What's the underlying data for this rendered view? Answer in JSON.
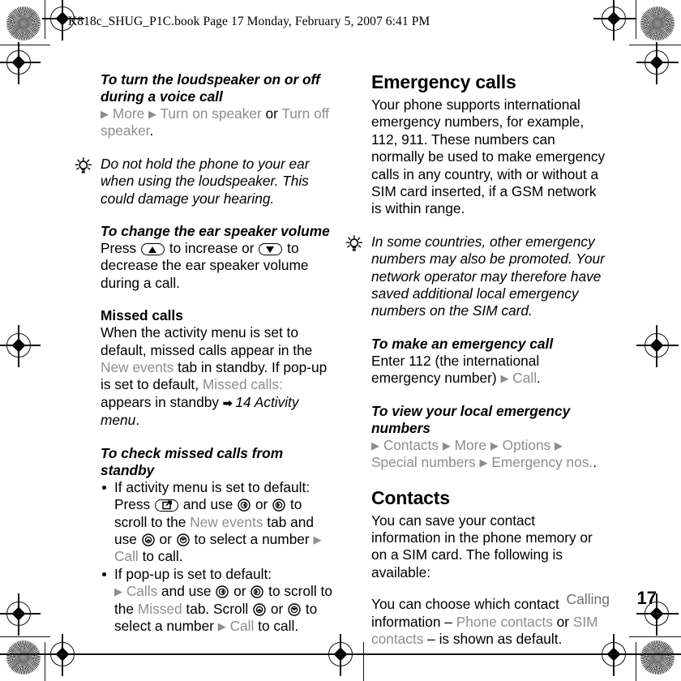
{
  "prepress": {
    "file_stamp": "K818c_SHUG_P1C.book  Page 17  Monday, February 5, 2007  6:41 PM"
  },
  "left_column": {
    "blocks": [
      {
        "kind": "task-heading",
        "text": "To turn the loudspeaker on or off during a voice call"
      },
      {
        "kind": "path",
        "parts": [
          "▸",
          "More",
          "▸",
          "Turn on speaker",
          "or",
          "Turn off speaker",
          "."
        ]
      },
      {
        "kind": "note",
        "icon": "lightbulb-icon",
        "text": "Do not hold the phone to your ear when using the loudspeaker. This could damage your hearing."
      },
      {
        "kind": "task-heading",
        "text": "To change the ear speaker volume"
      },
      {
        "kind": "body-with-keys",
        "segments": [
          "Press ",
          "volume-up-key",
          " to increase or ",
          "volume-down-key",
          " to decrease the ear speaker volume during a call."
        ]
      },
      {
        "kind": "sub-heading",
        "text": "Missed calls"
      },
      {
        "kind": "body",
        "text": "When the activity menu is set to default, missed calls appear in the New events tab in standby. If pop-up is set to default, Missed calls: appears in standby ➡ 14 Activity menu."
      },
      {
        "kind": "task-heading",
        "text": "To check missed calls from standby"
      },
      {
        "kind": "bullet",
        "text": "If activity menu is set to default: Press (activity key) and use (nav-left) or (nav-right) to scroll to the New events tab and use (nav-up) or (nav-down) to select a number ▸ Call to call."
      },
      {
        "kind": "bullet",
        "text": "If pop-up is set to default: ▸ Calls and use (nav-left) or (nav-right) to scroll to the Missed tab. Scroll (nav-up) or (nav-down) to select a number ▸ Call to call."
      }
    ],
    "t1_line1": "To turn the loudspeaker on or off",
    "t1_line2": "during a voice call",
    "p1_more": "More",
    "p1_turn_on": "Turn on speaker",
    "p1_or": "or",
    "p1_turn_off": "Turn off speaker",
    "note1": "Do not hold the phone to your ear when using the loudspeaker. This could damage your hearing.",
    "t2": "To change the ear speaker volume",
    "t2_a": "Press",
    "t2_b": "to increase or",
    "t2_c": "to decrease the ear speaker volume during a call.",
    "h_missed": "Missed calls",
    "missed_a": "When the activity menu is set to default, missed calls appear in the",
    "missed_new_events": "New events",
    "missed_b": "tab in standby. If pop-up is set to default,",
    "missed_calls_label": "Missed calls:",
    "missed_c": "appears in standby",
    "missed_ref": "14 Activity menu",
    "t3": "To check missed calls from standby",
    "b1_a": "If activity menu is set to default: Press",
    "b1_b": "and use",
    "b1_or1": "or",
    "b1_c": "to scroll to the",
    "b1_new_events": "New events",
    "b1_d": "tab and use",
    "b1_or2": "or",
    "b1_e": "to select a number",
    "b1_call": "Call",
    "b1_f": "to call.",
    "b2_a": "If pop-up is set to default:",
    "b2_calls": "Calls",
    "b2_b": "and use",
    "b2_or1": "or",
    "b2_c": "to scroll to the",
    "b2_missed": "Missed",
    "b2_d": "tab. Scroll",
    "b2_or2": "or",
    "b2_e": "to select a number",
    "b2_call": "Call",
    "b2_f": "to call."
  },
  "right_column": {
    "h_emergency": "Emergency calls",
    "emergency_body": "Your phone supports international emergency numbers, for example, 112, 911. These numbers can normally be used to make emergency calls in any country, with or without a SIM card inserted, if a GSM network is within range.",
    "note2": "In some countries, other emergency numbers may also be promoted. Your network operator may therefore have saved additional local emergency numbers on the SIM card.",
    "t_make_call": "To make an emergency call",
    "make_call_a": "Enter 112 (the international emergency number)",
    "make_call_btn": "Call",
    "make_call_dot": ".",
    "t_view_line1": "To view your local emergency",
    "t_view_line2": "numbers",
    "path_contacts": "Contacts",
    "path_more": "More",
    "path_options": "Options",
    "path_special": "Special numbers",
    "path_emerg_nos": "Emergency nos.",
    "path_dot": ".",
    "h_contacts": "Contacts",
    "contacts_body1": "You can save your contact information in the phone memory or on a SIM card. The following is available:",
    "contacts_body2_a": "You can choose which contact information –",
    "contacts_phone": "Phone contacts",
    "contacts_or": "or",
    "contacts_sim": "SIM contacts",
    "contacts_body2_b": "– is shown as default."
  },
  "footer": {
    "section": "Calling",
    "page_number": "17"
  },
  "colors": {
    "ui_grey": "#8d8d8d",
    "footer_grey": "#6f6f6f",
    "text": "#000000",
    "background": "#ffffff"
  },
  "icons": {
    "lightbulb": "lightbulb-icon",
    "solid_right_arrow": "solid-right-arrow-icon",
    "small_right_arrow": "small-right-arrow-icon",
    "volume_up_key": "volume-up-key-icon",
    "volume_down_key": "volume-down-key-icon",
    "activity_menu_key": "activity-menu-key-icon",
    "nav_left": "nav-left-key-icon",
    "nav_right": "nav-right-key-icon",
    "nav_up": "nav-up-key-icon",
    "nav_down": "nav-down-key-icon",
    "registration_mark": "registration-mark-icon",
    "color_starburst": "starburst-calibration-icon"
  }
}
